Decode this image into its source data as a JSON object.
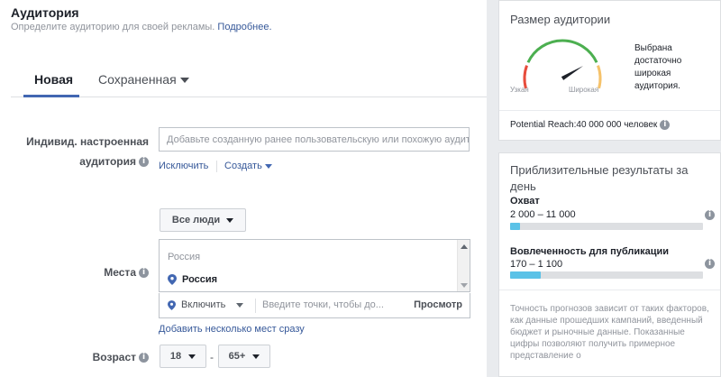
{
  "audience": {
    "title": "Аудитория",
    "subtitle": "Определите аудиторию для своей рекламы.",
    "learn_more": "Подробнее."
  },
  "tabs": {
    "new_label": "Новая",
    "saved_label": "Сохраненная"
  },
  "custom_audience": {
    "label_line1": "Индивид. настроенная",
    "label_line2": "аудитория",
    "placeholder": "Добавьте созданную ранее пользовательскую или похожую аудиторию",
    "exclude_label": "Исключить",
    "create_label": "Создать"
  },
  "locations": {
    "label": "Места",
    "people_selector": "Все люди",
    "country_header": "Россия",
    "selected_item": "Россия",
    "include_label": "Включить",
    "search_placeholder": "Введите точки, чтобы до...",
    "browse_label": "Просмотр",
    "bulk_link": "Добавить несколько мест сразу"
  },
  "age": {
    "label": "Возраст",
    "min": "18",
    "separator": "-",
    "max": "65+"
  },
  "audience_size": {
    "title": "Размер аудитории",
    "narrow_label": "Узкая",
    "wide_label": "Широкая",
    "description": "Выбрана достаточно широкая аудитория.",
    "reach_label": "Potential Reach:",
    "reach_value": "40 000 000 человек",
    "gauge_level": 0.78
  },
  "estimated_results": {
    "title": "Приблизительные результаты за день",
    "reach_name": "Охват",
    "reach_range": "2 000 – 11 000",
    "reach_fill": 0.05,
    "engagement_name": "Вовлеченность для публикации",
    "engagement_range": "170 – 1 100",
    "engagement_fill": 0.16,
    "note": "Точность прогнозов зависит от таких факторов, как данные прошедших кампаний, введенный бюджет и рыночные данные. Показанные цифры позволяют получить примерное представление о"
  },
  "colors": {
    "accent": "#4267b2",
    "link": "#365899",
    "bar_fill": "#5bc2e7",
    "gauge_red": "#e74c3c",
    "gauge_green": "#4caf50",
    "gauge_yellow": "#f5c26b"
  }
}
